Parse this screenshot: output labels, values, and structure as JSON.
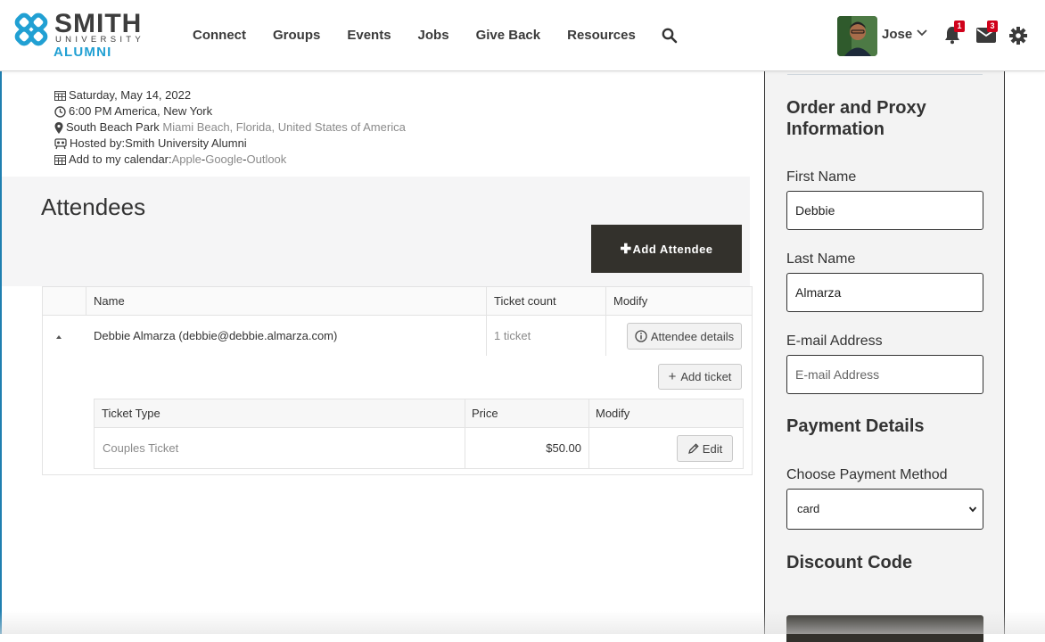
{
  "brand": {
    "name": "SMITH",
    "sub": "UNIVERSITY",
    "alumni": "ALUMNI",
    "accent": "#21a0d3"
  },
  "nav": {
    "items": [
      "Connect",
      "Groups",
      "Events",
      "Jobs",
      "Give Back",
      "Resources"
    ]
  },
  "user": {
    "name": "Jose",
    "notification_count": "1",
    "message_count": "3"
  },
  "event": {
    "date": "Saturday, May 14, 2022",
    "time": "6:00 PM America, New York",
    "venue": "South Beach Park",
    "location": "Miami Beach, Florida, United States of America",
    "host_prefix": "Hosted by: ",
    "host": "Smith University Alumni",
    "calendar_prefix": "Add to my calendar: ",
    "cal_apple": "Apple",
    "cal_google": "Google",
    "cal_outlook": "Outlook",
    "separator": " - "
  },
  "attendees": {
    "title": "Attendees",
    "add_label": "Add Attendee",
    "table": {
      "headers": [
        "Name",
        "Ticket count",
        "Modify"
      ],
      "row": {
        "name": "Debbie Almarza (debbie@debbie.almarza.com)",
        "ticket_count": "1 ticket",
        "details_label": "Attendee details"
      },
      "add_ticket_label": "Add ticket",
      "sub_headers": [
        "Ticket Type",
        "Price",
        "Modify"
      ],
      "ticket": {
        "type": "Couples Ticket",
        "price": "$50.00",
        "edit_label": "Edit"
      }
    }
  },
  "order": {
    "title": "Order and Proxy Information",
    "first_name_label": "First Name",
    "first_name_value": "Debbie",
    "last_name_label": "Last Name",
    "last_name_value": "Almarza",
    "email_label": "E-mail Address",
    "email_placeholder": "E-mail Address",
    "payment_title": "Payment Details",
    "payment_method_label": "Choose Payment Method",
    "payment_method_value": "card",
    "discount_title": "Discount Code"
  }
}
